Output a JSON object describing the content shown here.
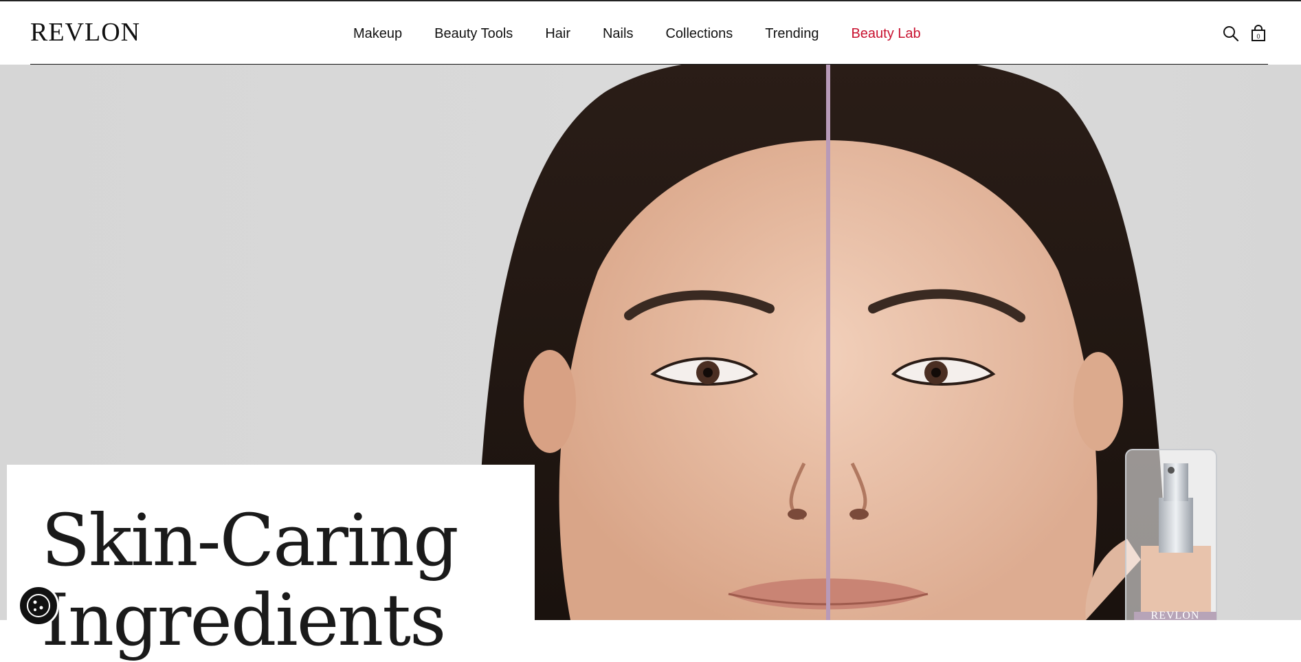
{
  "brand": {
    "logo_text": "REVLON"
  },
  "nav": {
    "items": [
      {
        "label": "Makeup"
      },
      {
        "label": "Beauty Tools"
      },
      {
        "label": "Hair"
      },
      {
        "label": "Nails"
      },
      {
        "label": "Collections"
      },
      {
        "label": "Trending"
      },
      {
        "label": "Beauty Lab"
      }
    ]
  },
  "header_icons": {
    "search": "search-icon",
    "bag": "shopping-bag-icon",
    "bag_count": "0"
  },
  "hero": {
    "headline_line1": "Skin-Caring",
    "headline_line2": "Ingredients",
    "bottle_text": "REVLON"
  },
  "colors": {
    "accent": "#c8102e",
    "divider_line": "#b89ab8",
    "hero_bg": "#d8d8d8"
  }
}
